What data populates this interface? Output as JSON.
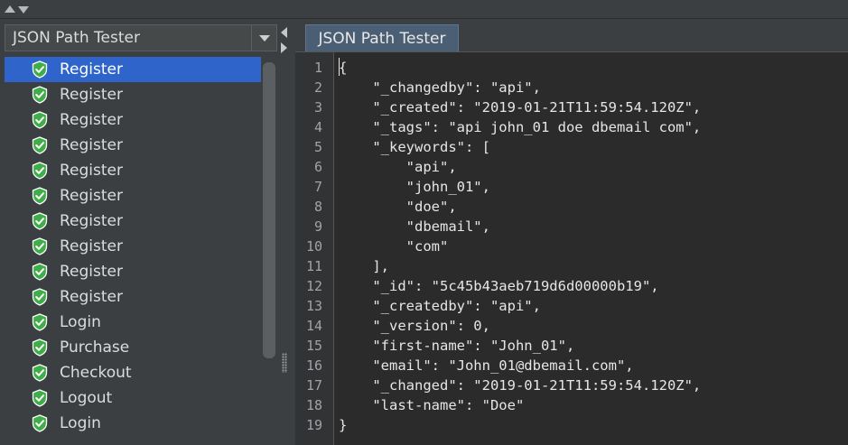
{
  "sampler_list": {
    "dropdown_value": "JSON Path Tester",
    "items": [
      {
        "label": "Register",
        "selected": true
      },
      {
        "label": "Register"
      },
      {
        "label": "Register"
      },
      {
        "label": "Register"
      },
      {
        "label": "Register"
      },
      {
        "label": "Register"
      },
      {
        "label": "Register"
      },
      {
        "label": "Register"
      },
      {
        "label": "Register"
      },
      {
        "label": "Register"
      },
      {
        "label": "Login"
      },
      {
        "label": "Purchase"
      },
      {
        "label": "Checkout"
      },
      {
        "label": "Logout"
      },
      {
        "label": "Login"
      }
    ]
  },
  "result_panel": {
    "tab_label": "JSON Path Tester",
    "line_numbers": [
      "1",
      "2",
      "3",
      "4",
      "5",
      "6",
      "7",
      "8",
      "9",
      "10",
      "11",
      "12",
      "13",
      "14",
      "15",
      "16",
      "17",
      "18",
      "19"
    ],
    "lines": [
      "{",
      "    \"_changedby\": \"api\",",
      "    \"_created\": \"2019-01-21T11:59:54.120Z\",",
      "    \"_tags\": \"api john_01 doe dbemail com\",",
      "    \"_keywords\": [",
      "        \"api\",",
      "        \"john_01\",",
      "        \"doe\",",
      "        \"dbemail\",",
      "        \"com\"",
      "    ],",
      "    \"_id\": \"5c45b43aeb719d6d00000b19\",",
      "    \"_createdby\": \"api\",",
      "    \"_version\": 0,",
      "    \"first-name\": \"John_01\",",
      "    \"email\": \"John_01@dbemail.com\",",
      "    \"_changed\": \"2019-01-21T11:59:54.120Z\",",
      "    \"last-name\": \"Doe\"",
      "}"
    ]
  },
  "colors": {
    "selection": "#2f65ca",
    "shield": "#3fae49",
    "tab": "#4b5f74"
  },
  "icons": {
    "item_icon": "shield-check-icon"
  }
}
